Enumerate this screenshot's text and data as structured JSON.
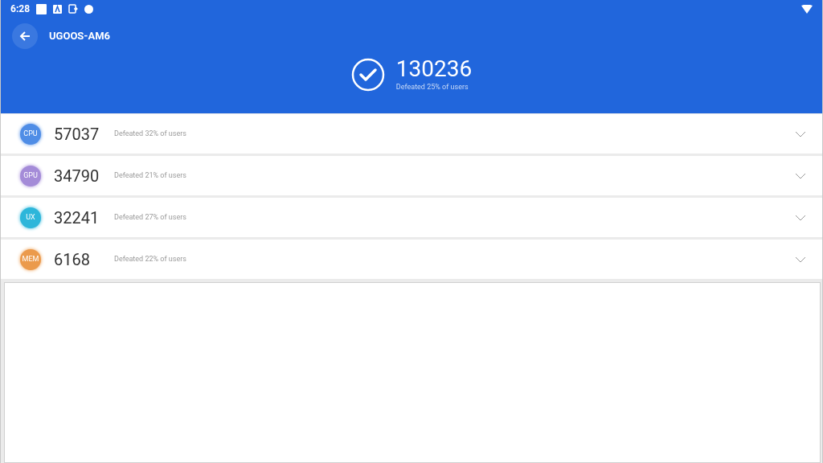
{
  "status_bar": {
    "time": "6:28"
  },
  "header": {
    "title": "UGOOS-AM6",
    "score": "130236",
    "subtitle": "Defeated 25% of users"
  },
  "results": [
    {
      "badge": "CPU",
      "color": "#4f8de6",
      "score": "57037",
      "subtitle": "Defeated 32% of users"
    },
    {
      "badge": "GPU",
      "color": "#a48bd8",
      "score": "34790",
      "subtitle": "Defeated 21% of users"
    },
    {
      "badge": "UX",
      "color": "#2db6da",
      "score": "32241",
      "subtitle": "Defeated 27% of users"
    },
    {
      "badge": "MEM",
      "color": "#eb9a4c",
      "score": "6168",
      "subtitle": "Defeated 22% of users"
    }
  ]
}
